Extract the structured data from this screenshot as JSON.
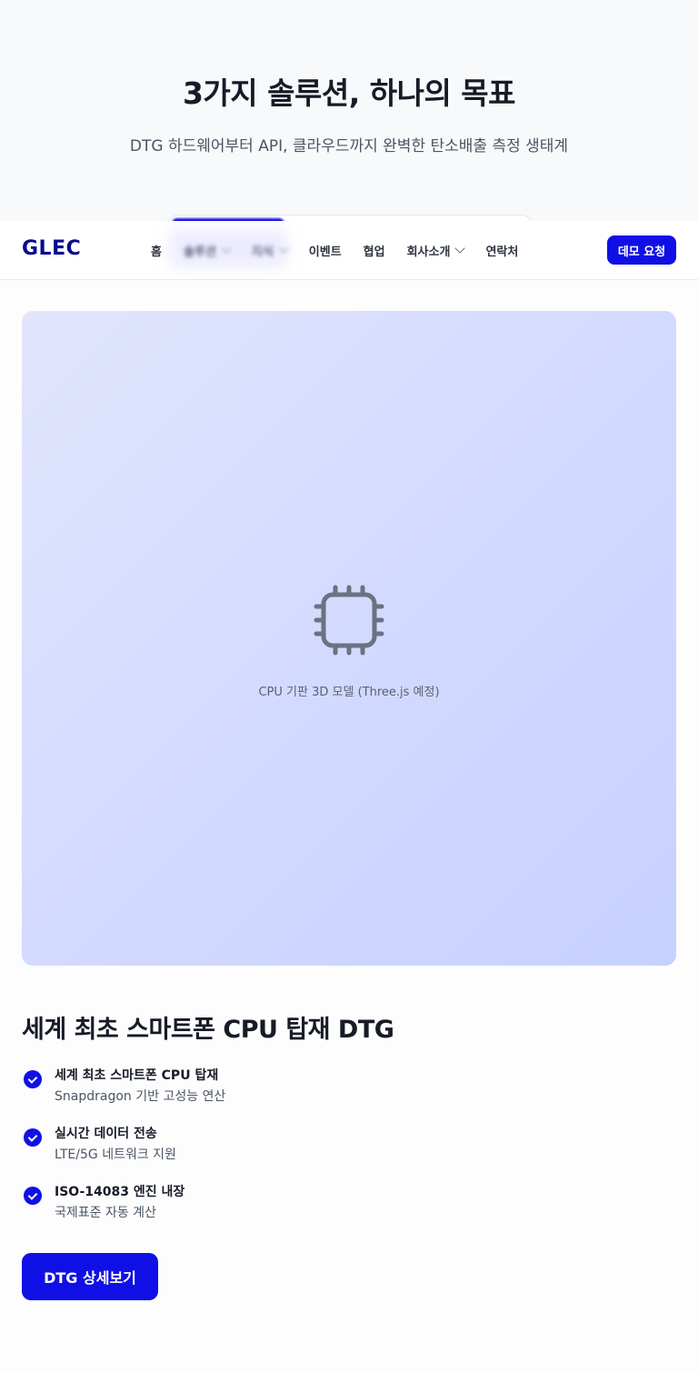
{
  "hero": {
    "title": "3가지 솔루션, 하나의 목표",
    "subtitle": "DTG 하드웨어부터 API, 클라우드까지 완벽한 탄소배출 측정 생태계"
  },
  "header": {
    "logo": "GLEC",
    "nav": [
      {
        "label": "홈"
      },
      {
        "label": "솔루션"
      },
      {
        "label": "지식"
      },
      {
        "label": "이벤트"
      },
      {
        "label": "협업"
      },
      {
        "label": "회사소개"
      },
      {
        "label": "연락처"
      }
    ],
    "demo_button": "데모 요청"
  },
  "model": {
    "icon": "cpu-icon",
    "caption": "CPU 기판 3D 모델 (Three.js 예정)"
  },
  "section": {
    "title": "세계 최초 스마트폰 CPU 탑재 DTG",
    "features": [
      {
        "title": "세계 최초 스마트폰 CPU 탑재",
        "desc": "Snapdragon 기반 고성능 연산"
      },
      {
        "title": "실시간 데이터 전송",
        "desc": "LTE/5G 네트워크 지원"
      },
      {
        "title": "ISO-14083 엔진 내장",
        "desc": "국제표준 자동 계산"
      }
    ],
    "cta": "DTG 상세보기"
  },
  "colors": {
    "accent": "#1010e6",
    "logo": "#0a0a8c"
  }
}
